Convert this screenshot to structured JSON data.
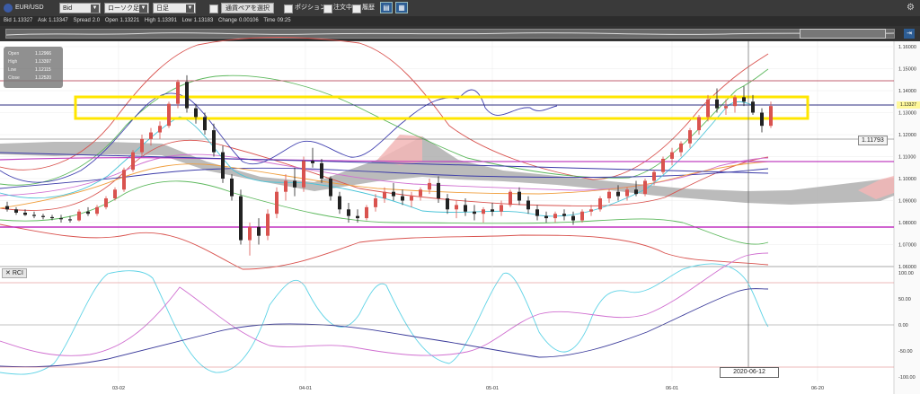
{
  "toolbar": {
    "symbol": "EUR/USD",
    "price_type": "Bid",
    "chart_type": "ローソク足",
    "timeframe": "日足",
    "pair_select_label": "通貨ペアを選択",
    "position_label": "ポジション",
    "order_label": "注文中",
    "history_label": "履歴"
  },
  "infobar": {
    "bid_label": "Bid",
    "bid": "1.13327",
    "ask_label": "Ask",
    "ask": "1.13347",
    "spread_label": "Spread",
    "spread": "2.0",
    "open_label": "Open",
    "open": "1.13221",
    "high_label": "High",
    "high": "1.13391",
    "low_label": "Low",
    "low": "1.13183",
    "change_label": "Change",
    "change": "0.00106",
    "time_label": "Time",
    "time": "09:25"
  },
  "ohlc_box": {
    "open_label": "Open",
    "open": "1.12966",
    "high_label": "High",
    "high": "1.13397",
    "low_label": "Low",
    "low": "1.12115",
    "close_label": "Close",
    "close": "1.12520"
  },
  "price_tag": "1.11793",
  "current_price": "1.13327",
  "rci_label": "RCI",
  "crosshair_date": "2020-06-12",
  "chart_data": [
    {
      "type": "candlestick",
      "x_ticks": [
        "03-02",
        "04-01",
        "05-01",
        "06-01",
        "06-20"
      ],
      "y_ticks": [
        1.16,
        1.15,
        1.14,
        1.13,
        1.12,
        1.11,
        1.1,
        1.09,
        1.08,
        1.07,
        1.06
      ],
      "ylim": [
        1.06,
        1.16
      ],
      "candles": [
        [
          1.0875,
          1.0895,
          1.085,
          1.086
        ],
        [
          1.086,
          1.087,
          1.0835,
          1.0845
        ],
        [
          1.0845,
          1.086,
          1.083,
          1.0835
        ],
        [
          1.0835,
          1.085,
          1.082,
          1.083
        ],
        [
          1.083,
          1.084,
          1.0815,
          1.0825
        ],
        [
          1.0825,
          1.0835,
          1.081,
          1.082
        ],
        [
          1.082,
          1.0835,
          1.08,
          1.0815
        ],
        [
          1.0815,
          1.083,
          1.08,
          1.081
        ],
        [
          1.081,
          1.086,
          1.0805,
          1.085
        ],
        [
          1.085,
          1.087,
          1.083,
          1.084
        ],
        [
          1.084,
          1.088,
          1.083,
          1.087
        ],
        [
          1.087,
          1.092,
          1.086,
          1.091
        ],
        [
          1.091,
          1.096,
          1.09,
          1.095
        ],
        [
          1.095,
          1.105,
          1.094,
          1.104
        ],
        [
          1.104,
          1.113,
          1.103,
          1.112
        ],
        [
          1.112,
          1.12,
          1.11,
          1.118
        ],
        [
          1.118,
          1.123,
          1.115,
          1.121
        ],
        [
          1.121,
          1.126,
          1.118,
          1.124
        ],
        [
          1.124,
          1.135,
          1.123,
          1.134
        ],
        [
          1.134,
          1.145,
          1.132,
          1.144
        ],
        [
          1.144,
          1.147,
          1.13,
          1.132
        ],
        [
          1.132,
          1.134,
          1.125,
          1.128
        ],
        [
          1.128,
          1.13,
          1.12,
          1.122
        ],
        [
          1.122,
          1.125,
          1.11,
          1.112
        ],
        [
          1.112,
          1.115,
          1.098,
          1.1
        ],
        [
          1.1,
          1.102,
          1.09,
          1.092
        ],
        [
          1.092,
          1.095,
          1.07,
          1.072
        ],
        [
          1.072,
          1.08,
          1.065,
          1.078
        ],
        [
          1.078,
          1.082,
          1.07,
          1.074
        ],
        [
          1.074,
          1.086,
          1.072,
          1.084
        ],
        [
          1.084,
          1.096,
          1.082,
          1.094
        ],
        [
          1.094,
          1.102,
          1.09,
          1.099
        ],
        [
          1.099,
          1.105,
          1.092,
          1.096
        ],
        [
          1.096,
          1.11,
          1.094,
          1.108
        ],
        [
          1.108,
          1.114,
          1.105,
          1.107
        ],
        [
          1.107,
          1.109,
          1.098,
          1.1
        ],
        [
          1.1,
          1.101,
          1.09,
          1.092
        ],
        [
          1.092,
          1.094,
          1.084,
          1.086
        ],
        [
          1.086,
          1.089,
          1.08,
          1.083
        ],
        [
          1.083,
          1.086,
          1.08,
          1.082
        ],
        [
          1.082,
          1.088,
          1.081,
          1.087
        ],
        [
          1.087,
          1.093,
          1.085,
          1.091
        ],
        [
          1.091,
          1.096,
          1.089,
          1.094
        ],
        [
          1.094,
          1.098,
          1.09,
          1.092
        ],
        [
          1.092,
          1.095,
          1.088,
          1.09
        ],
        [
          1.09,
          1.094,
          1.087,
          1.092
        ],
        [
          1.092,
          1.096,
          1.09,
          1.095
        ],
        [
          1.095,
          1.1,
          1.093,
          1.098
        ],
        [
          1.098,
          1.101,
          1.089,
          1.091
        ],
        [
          1.091,
          1.093,
          1.084,
          1.086
        ],
        [
          1.086,
          1.09,
          1.082,
          1.088
        ],
        [
          1.088,
          1.091,
          1.083,
          1.085
        ],
        [
          1.085,
          1.088,
          1.081,
          1.084
        ],
        [
          1.084,
          1.087,
          1.08,
          1.086
        ],
        [
          1.086,
          1.089,
          1.083,
          1.085
        ],
        [
          1.085,
          1.09,
          1.083,
          1.088
        ],
        [
          1.088,
          1.095,
          1.087,
          1.094
        ],
        [
          1.094,
          1.096,
          1.088,
          1.09
        ],
        [
          1.09,
          1.092,
          1.084,
          1.086
        ],
        [
          1.086,
          1.088,
          1.081,
          1.083
        ],
        [
          1.083,
          1.085,
          1.08,
          1.082
        ],
        [
          1.082,
          1.085,
          1.08,
          1.084
        ],
        [
          1.084,
          1.086,
          1.081,
          1.083
        ],
        [
          1.083,
          1.085,
          1.079,
          1.081
        ],
        [
          1.081,
          1.086,
          1.08,
          1.085
        ],
        [
          1.085,
          1.088,
          1.083,
          1.086
        ],
        [
          1.086,
          1.092,
          1.085,
          1.091
        ],
        [
          1.091,
          1.095,
          1.089,
          1.094
        ],
        [
          1.094,
          1.097,
          1.09,
          1.092
        ],
        [
          1.092,
          1.096,
          1.09,
          1.095
        ],
        [
          1.095,
          1.099,
          1.092,
          1.093
        ],
        [
          1.093,
          1.1,
          1.092,
          1.099
        ],
        [
          1.099,
          1.104,
          1.097,
          1.103
        ],
        [
          1.103,
          1.11,
          1.102,
          1.109
        ],
        [
          1.109,
          1.114,
          1.106,
          1.112
        ],
        [
          1.112,
          1.117,
          1.11,
          1.116
        ],
        [
          1.116,
          1.123,
          1.114,
          1.122
        ],
        [
          1.122,
          1.129,
          1.12,
          1.128
        ],
        [
          1.128,
          1.138,
          1.126,
          1.136
        ],
        [
          1.136,
          1.141,
          1.13,
          1.132
        ],
        [
          1.132,
          1.136,
          1.129,
          1.133
        ],
        [
          1.133,
          1.138,
          1.13,
          1.137
        ],
        [
          1.137,
          1.142,
          1.133,
          1.135
        ],
        [
          1.135,
          1.138,
          1.129,
          1.13
        ],
        [
          1.13,
          1.132,
          1.121,
          1.124
        ],
        [
          1.124,
          1.135,
          1.123,
          1.133
        ]
      ]
    },
    {
      "type": "line",
      "title": "RCI",
      "y_ticks": [
        100,
        50,
        0,
        -50,
        -100
      ],
      "ylim": [
        -100,
        100
      ]
    }
  ]
}
